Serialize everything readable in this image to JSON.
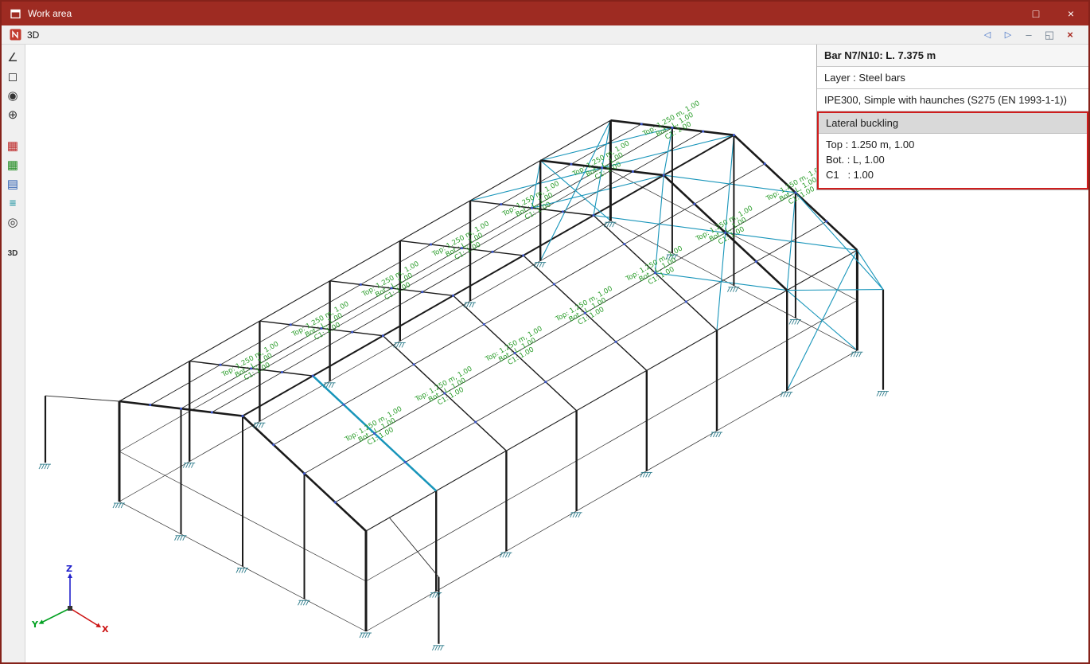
{
  "window": {
    "title": "Work area",
    "maximize_label": "□",
    "close_label": "×"
  },
  "tab_bar": {
    "tab": "3D",
    "nav_prev": "◁",
    "nav_next": "▷",
    "minimize": "–",
    "restore": "◱",
    "close": "×"
  },
  "toolbar": {
    "icons": [
      {
        "name": "workplane-icon",
        "glyph": "∠",
        "color": "#333333"
      },
      {
        "name": "cube-view-icon",
        "glyph": "◻",
        "color": "#333333"
      },
      {
        "name": "visibility-icon",
        "glyph": "◉",
        "color": "#333333"
      },
      {
        "name": "pan-icon",
        "glyph": "⊕",
        "color": "#333333"
      },
      {
        "name": "section-table-icon",
        "glyph": "▦",
        "color": "#bb2222"
      },
      {
        "name": "result-table-icon",
        "glyph": "▦",
        "color": "#1d8a1d"
      },
      {
        "name": "data-table-icon",
        "glyph": "▤",
        "color": "#2a5db0"
      },
      {
        "name": "layers-icon",
        "glyph": "≡",
        "color": "#0a8a9a"
      },
      {
        "name": "hide-elements-icon",
        "glyph": "◎",
        "color": "#333333"
      },
      {
        "name": "view-3d-icon",
        "glyph": "3D",
        "color": "#333333"
      }
    ]
  },
  "info_panel": {
    "title": "Bar N7/N10: L. 7.375 m",
    "layer": "Layer : Steel bars",
    "section": "IPE300, Simple with haunches (S275 (EN 1993-1-1))",
    "lateral_buckling": {
      "header": "Lateral buckling",
      "rows": [
        "Top : 1.250 m, 1.00",
        "Bot. : L, 1.00",
        "C1   : 1.00"
      ]
    }
  },
  "annotation": {
    "lines": [
      "Top: 1.250 m, 1.00",
      "Bot.: L, 1.00",
      "C1: 1.00"
    ],
    "color": "#249a24"
  },
  "axes": {
    "x": "X",
    "y": "Y",
    "z": "Z"
  },
  "colors": {
    "titlebar": "#9e2b22",
    "bracing_cyan": "#1895ba",
    "member_black": "#1a1a1a",
    "support_teal": "#2f7d8c",
    "node_blue": "#3a55c8",
    "highlight_red": "#cf1d1d"
  }
}
